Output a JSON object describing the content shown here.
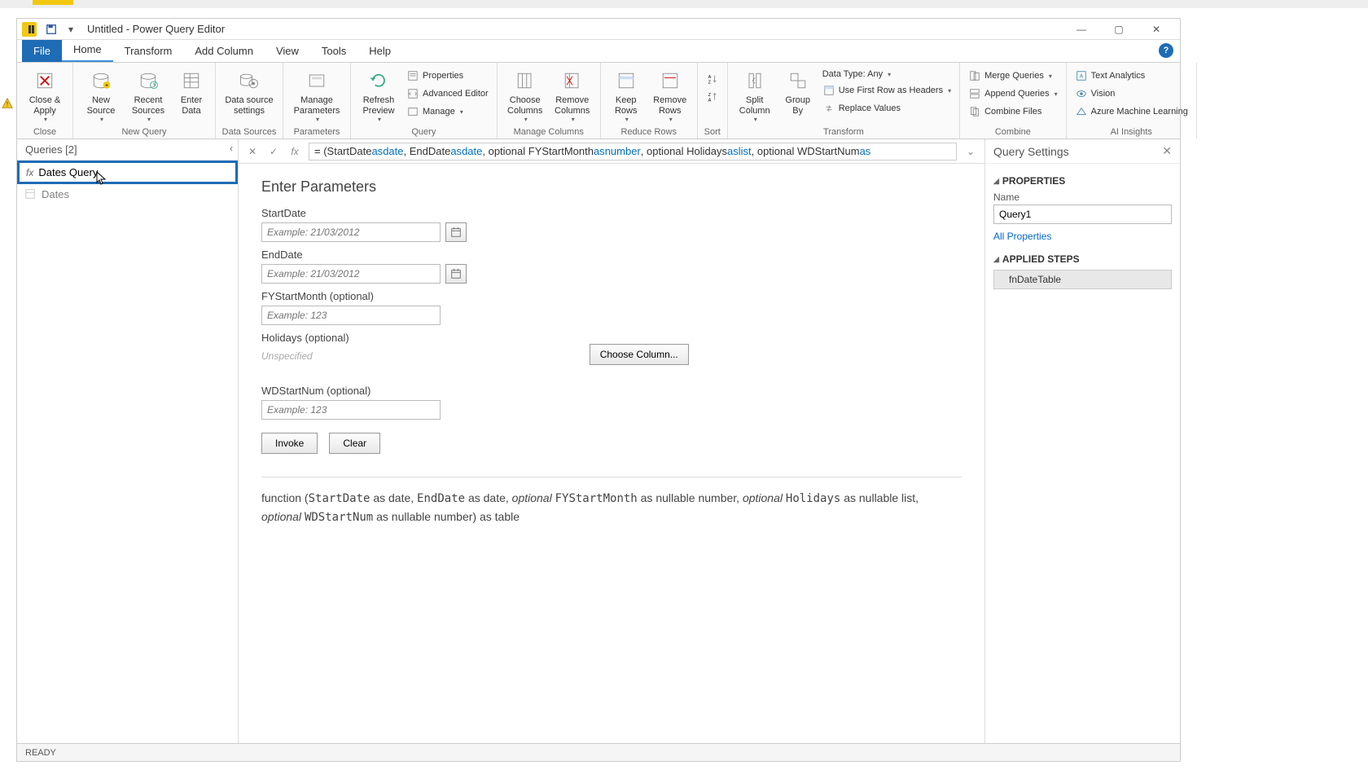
{
  "window": {
    "title": "Untitled - Power Query Editor"
  },
  "tabs": {
    "file": "File",
    "home": "Home",
    "transform": "Transform",
    "add_column": "Add Column",
    "view": "View",
    "tools": "Tools",
    "help": "Help"
  },
  "ribbon": {
    "close": {
      "close_apply": "Close &\nApply",
      "group": "Close"
    },
    "new_query": {
      "new_source": "New\nSource",
      "recent_sources": "Recent\nSources",
      "enter_data": "Enter\nData",
      "group": "New Query"
    },
    "data_sources": {
      "data_source_settings": "Data source\nsettings",
      "group": "Data Sources"
    },
    "parameters": {
      "manage_parameters": "Manage\nParameters",
      "group": "Parameters"
    },
    "query": {
      "refresh_preview": "Refresh\nPreview",
      "properties": "Properties",
      "advanced_editor": "Advanced Editor",
      "manage": "Manage",
      "group": "Query"
    },
    "manage_columns": {
      "choose_columns": "Choose\nColumns",
      "remove_columns": "Remove\nColumns",
      "group": "Manage Columns"
    },
    "reduce_rows": {
      "keep_rows": "Keep\nRows",
      "remove_rows": "Remove\nRows",
      "group": "Reduce Rows"
    },
    "sort": {
      "group": "Sort"
    },
    "transform": {
      "split_column": "Split\nColumn",
      "group_by": "Group\nBy",
      "data_type": "Data Type: Any",
      "first_row_headers": "Use First Row as Headers",
      "replace_values": "Replace Values",
      "group": "Transform"
    },
    "combine": {
      "merge": "Merge Queries",
      "append": "Append Queries",
      "combine_files": "Combine Files",
      "group": "Combine"
    },
    "ai": {
      "text_analytics": "Text Analytics",
      "vision": "Vision",
      "azure_ml": "Azure Machine Learning",
      "group": "AI Insights"
    }
  },
  "queries_pane": {
    "header": "Queries [2]",
    "item1": "Dates Query",
    "item2": "Dates"
  },
  "formula_bar": {
    "prefix": "= (StartDate ",
    "as1": "as",
    "t1": " date",
    "c1": ", EndDate ",
    "as2": "as",
    "t2": " date",
    "c2": ", optional FYStartMonth ",
    "as3": "as",
    "t3": " number",
    "c3": ", optional Holidays ",
    "as4": "as",
    "t4": " list",
    "c4": ", optional WDStartNum ",
    "as5": "as"
  },
  "params": {
    "title": "Enter Parameters",
    "start_date": "StartDate",
    "end_date": "EndDate",
    "date_placeholder": "Example: 21/03/2012",
    "fy_start": "FYStartMonth (optional)",
    "num_placeholder": "Example: 123",
    "holidays": "Holidays (optional)",
    "unspecified": "Unspecified",
    "choose_column": "Choose Column...",
    "wd_start": "WDStartNum (optional)",
    "invoke": "Invoke",
    "clear": "Clear",
    "sig_line1a": "function (",
    "sig_StartDate": "StartDate",
    "sig_asdate1": " as date, ",
    "sig_EndDate": "EndDate",
    "sig_asdate2": " as date, ",
    "sig_opt1": "optional ",
    "sig_FY": "FYStartMonth",
    "sig_asnum1": " as nullable number, ",
    "sig_opt2": "optional ",
    "sig_Hol": "Holidays",
    "sig_aslist": " as nullable list,",
    "sig_opt3": "optional ",
    "sig_WD": "WDStartNum",
    "sig_tail": " as nullable number) as table"
  },
  "settings": {
    "header": "Query Settings",
    "properties": "PROPERTIES",
    "name_label": "Name",
    "name_value": "Query1",
    "all_properties": "All Properties",
    "applied_steps": "APPLIED STEPS",
    "step1": "fnDateTable"
  },
  "status": {
    "ready": "READY"
  }
}
